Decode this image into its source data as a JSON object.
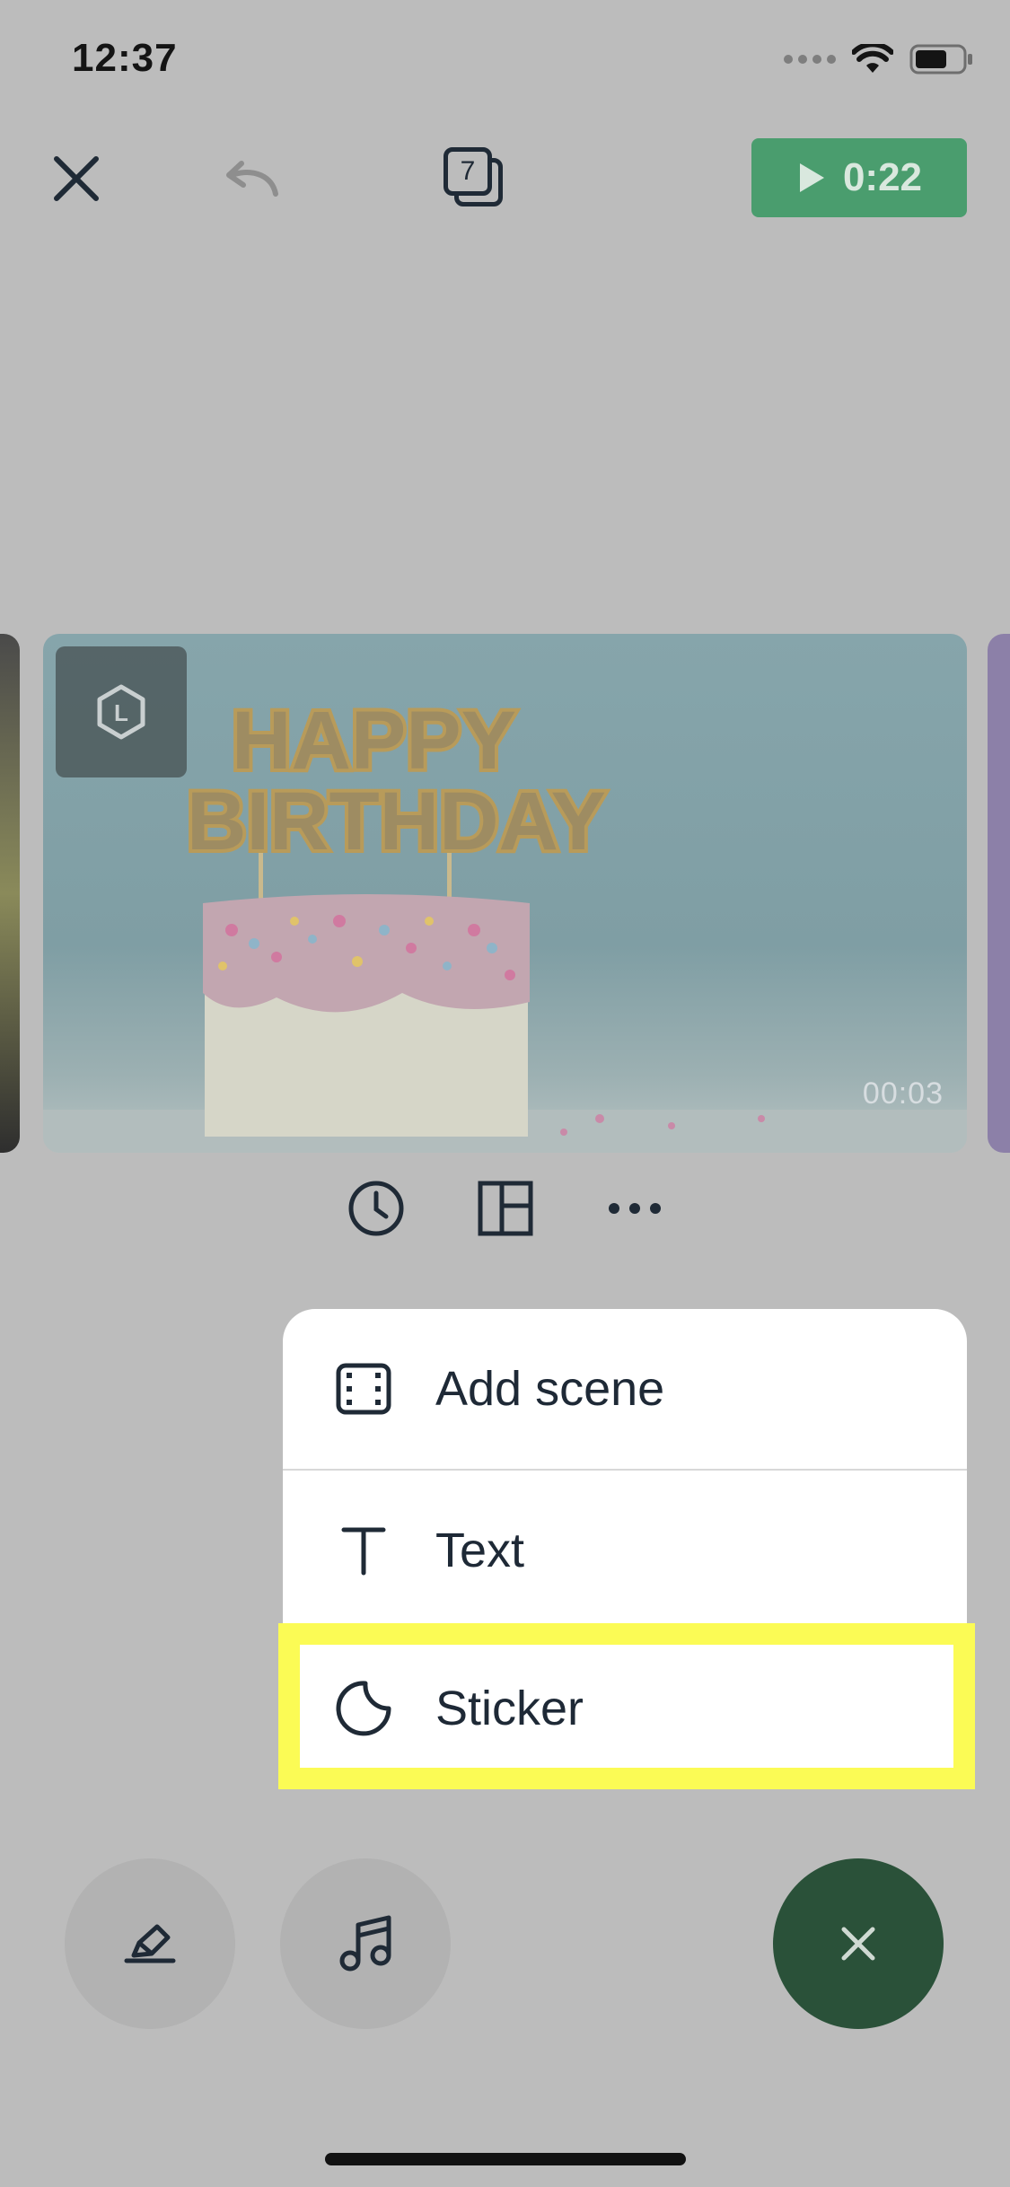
{
  "status_bar": {
    "time": "12:37"
  },
  "toolbar": {
    "scene_count": "7",
    "play_duration": "0:22"
  },
  "clip": {
    "duration": "00:03",
    "logo_letter": "L"
  },
  "menu": {
    "items": [
      {
        "label": "Add scene",
        "icon": "film-frame-icon"
      },
      {
        "label": "Text",
        "icon": "text-t-icon"
      },
      {
        "label": "Sticker",
        "icon": "sticker-icon"
      }
    ]
  },
  "colors": {
    "accent_green": "#4a9d6e",
    "fab_green": "#2a5139",
    "highlight": "#fbfb55"
  }
}
